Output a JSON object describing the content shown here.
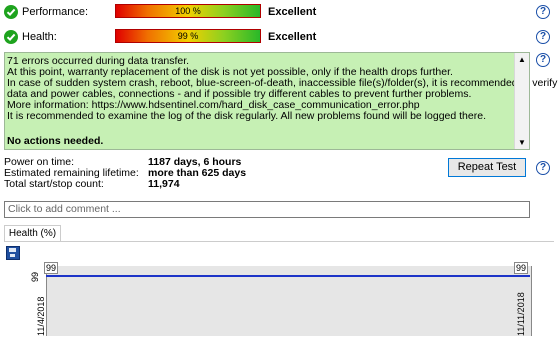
{
  "performance": {
    "label": "Performance:",
    "value": "100 %",
    "verdict": "Excellent"
  },
  "health": {
    "label": "Health:",
    "value": "99 %",
    "verdict": "Excellent"
  },
  "message": {
    "lines": [
      "71 errors occurred during data transfer.",
      "At this point, warranty replacement of the disk is not yet possible, only if the health drops further.",
      "In case of sudden system crash, reboot, blue-screen-of-death, inaccessible file(s)/folder(s), it is recommended to verify",
      "data and power cables, connections - and if possible try different cables to prevent further problems.",
      "More information: https://www.hdsentinel.com/hard_disk_case_communication_error.php",
      "It is recommended to examine the log of the disk regularly. All new problems found will be logged there."
    ],
    "footer": "No actions needed."
  },
  "stats": [
    {
      "label": "Power on time:",
      "value": "1187 days, 6 hours"
    },
    {
      "label": "Estimated remaining lifetime:",
      "value": "more than 625 days"
    },
    {
      "label": "Total start/stop count:",
      "value": "11,974"
    }
  ],
  "repeat_test_label": "Repeat Test",
  "comment_placeholder": "Click to add comment ...",
  "tab_label": "Health (%)",
  "chart_data": {
    "type": "line",
    "x": [
      "11/4/2018",
      "11/11/2018"
    ],
    "series": [
      {
        "values": [
          99,
          99
        ]
      }
    ],
    "point_labels": [
      "99",
      "99"
    ],
    "ylabel": "99",
    "line_color": "#1d34c8"
  }
}
